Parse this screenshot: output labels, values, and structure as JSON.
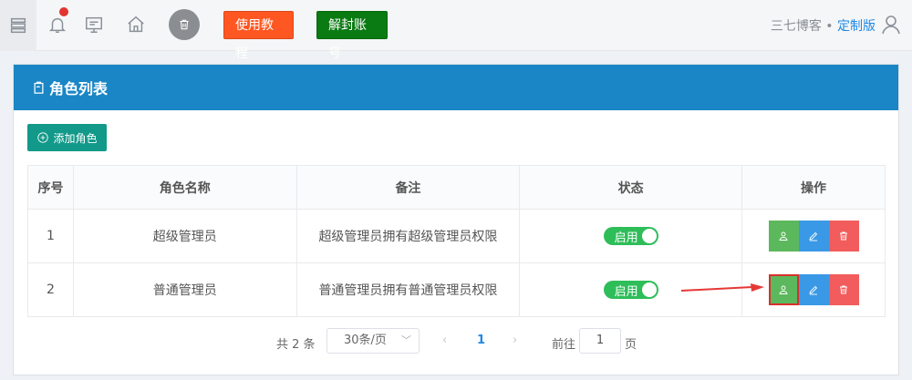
{
  "topbar": {
    "tutorial_label": "使用教程",
    "unlock_label": "解封账号",
    "brand_name": "三七博客",
    "brand_sep": "•",
    "brand_edition": "定制版"
  },
  "card": {
    "title": "角色列表",
    "add_label": "添加角色"
  },
  "table": {
    "headers": [
      "序号",
      "角色名称",
      "备注",
      "状态",
      "操作"
    ],
    "rows": [
      {
        "no": "1",
        "name": "超级管理员",
        "remark": "超级管理员拥有超级管理员权限",
        "status": "启用"
      },
      {
        "no": "2",
        "name": "普通管理员",
        "remark": "普通管理员拥有普通管理员权限",
        "status": "启用"
      }
    ]
  },
  "pager": {
    "total": "共 2 条",
    "page_size": "30条/页",
    "prev": "‹",
    "current": "1",
    "next": "›",
    "goto": "前往",
    "goto_value": "1",
    "page_unit": "页"
  },
  "colors": {
    "header_blue": "#1a86c6",
    "tutorial_orange": "#ff5722",
    "unlock_green": "#0a7a12",
    "add_teal": "#12998a",
    "toggle_green": "#2ebd59",
    "role_green": "#5cb85c",
    "edit_blue": "#3a99e6",
    "delete_red": "#f25c5c"
  }
}
